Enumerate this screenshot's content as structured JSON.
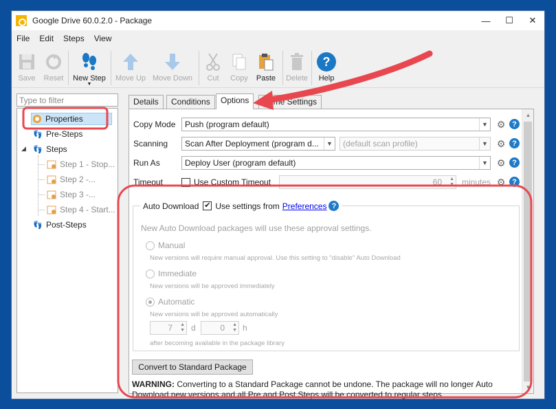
{
  "window": {
    "title": "Google Drive 60.0.2.0 - Package",
    "controls": {
      "minimize": "—",
      "maximize": "☐",
      "close": "✕"
    }
  },
  "menu": [
    "File",
    "Edit",
    "Steps",
    "View"
  ],
  "toolbar": {
    "save": "Save",
    "reset": "Reset",
    "new_step": "New Step",
    "move_up": "Move Up",
    "move_down": "Move Down",
    "cut": "Cut",
    "copy": "Copy",
    "paste": "Paste",
    "delete": "Delete",
    "help": "Help"
  },
  "filter": {
    "placeholder": "Type to filter"
  },
  "tree": {
    "properties": "Properties",
    "pre_steps": "Pre-Steps",
    "steps": "Steps",
    "step1": "Step 1 - Stop...",
    "step2": "Step 2 -...",
    "step3": "Step 3 -...",
    "step4": "Step 4 - Start...",
    "post_steps": "Post-Steps"
  },
  "tabs": {
    "details": "Details",
    "conditions": "Conditions",
    "options": "Options",
    "hidden": "ime Settings"
  },
  "options": {
    "copy_mode_label": "Copy Mode",
    "copy_mode_value": "Push (program default)",
    "scanning_label": "Scanning",
    "scanning_value": "Scan After Deployment (program d...",
    "scan_profile": "(default scan profile)",
    "run_as_label": "Run As",
    "run_as_value": "Deploy User (program default)",
    "timeout_label": "Timeout",
    "use_custom_timeout": "Use Custom Timeout",
    "timeout_value": "60",
    "minutes": "minutes"
  },
  "auto_download": {
    "label": "Auto Download",
    "use_settings": "Use settings from",
    "preferences_link": "Preferences",
    "info": "New Auto Download packages will use these approval settings.",
    "manual": "Manual",
    "manual_desc": "New versions will require manual approval. Use this setting to \"disable\" Auto Download",
    "immediate": "Immediate",
    "immediate_desc": "New versions will be approved immediately",
    "automatic": "Automatic",
    "automatic_desc": "New versions will be approved automatically",
    "days_value": "7",
    "days_unit": "d",
    "hours_value": "0",
    "hours_unit": "h",
    "after_text": "after becoming available in the package library"
  },
  "convert_button": "Convert to Standard Package",
  "warning": {
    "title": "WARNING:",
    "text": "Converting to a Standard Package cannot be undone. The package will no longer Auto Download new versions and all Pre and Post Steps will be converted to regular steps."
  },
  "annotation_color": "#e8474f"
}
